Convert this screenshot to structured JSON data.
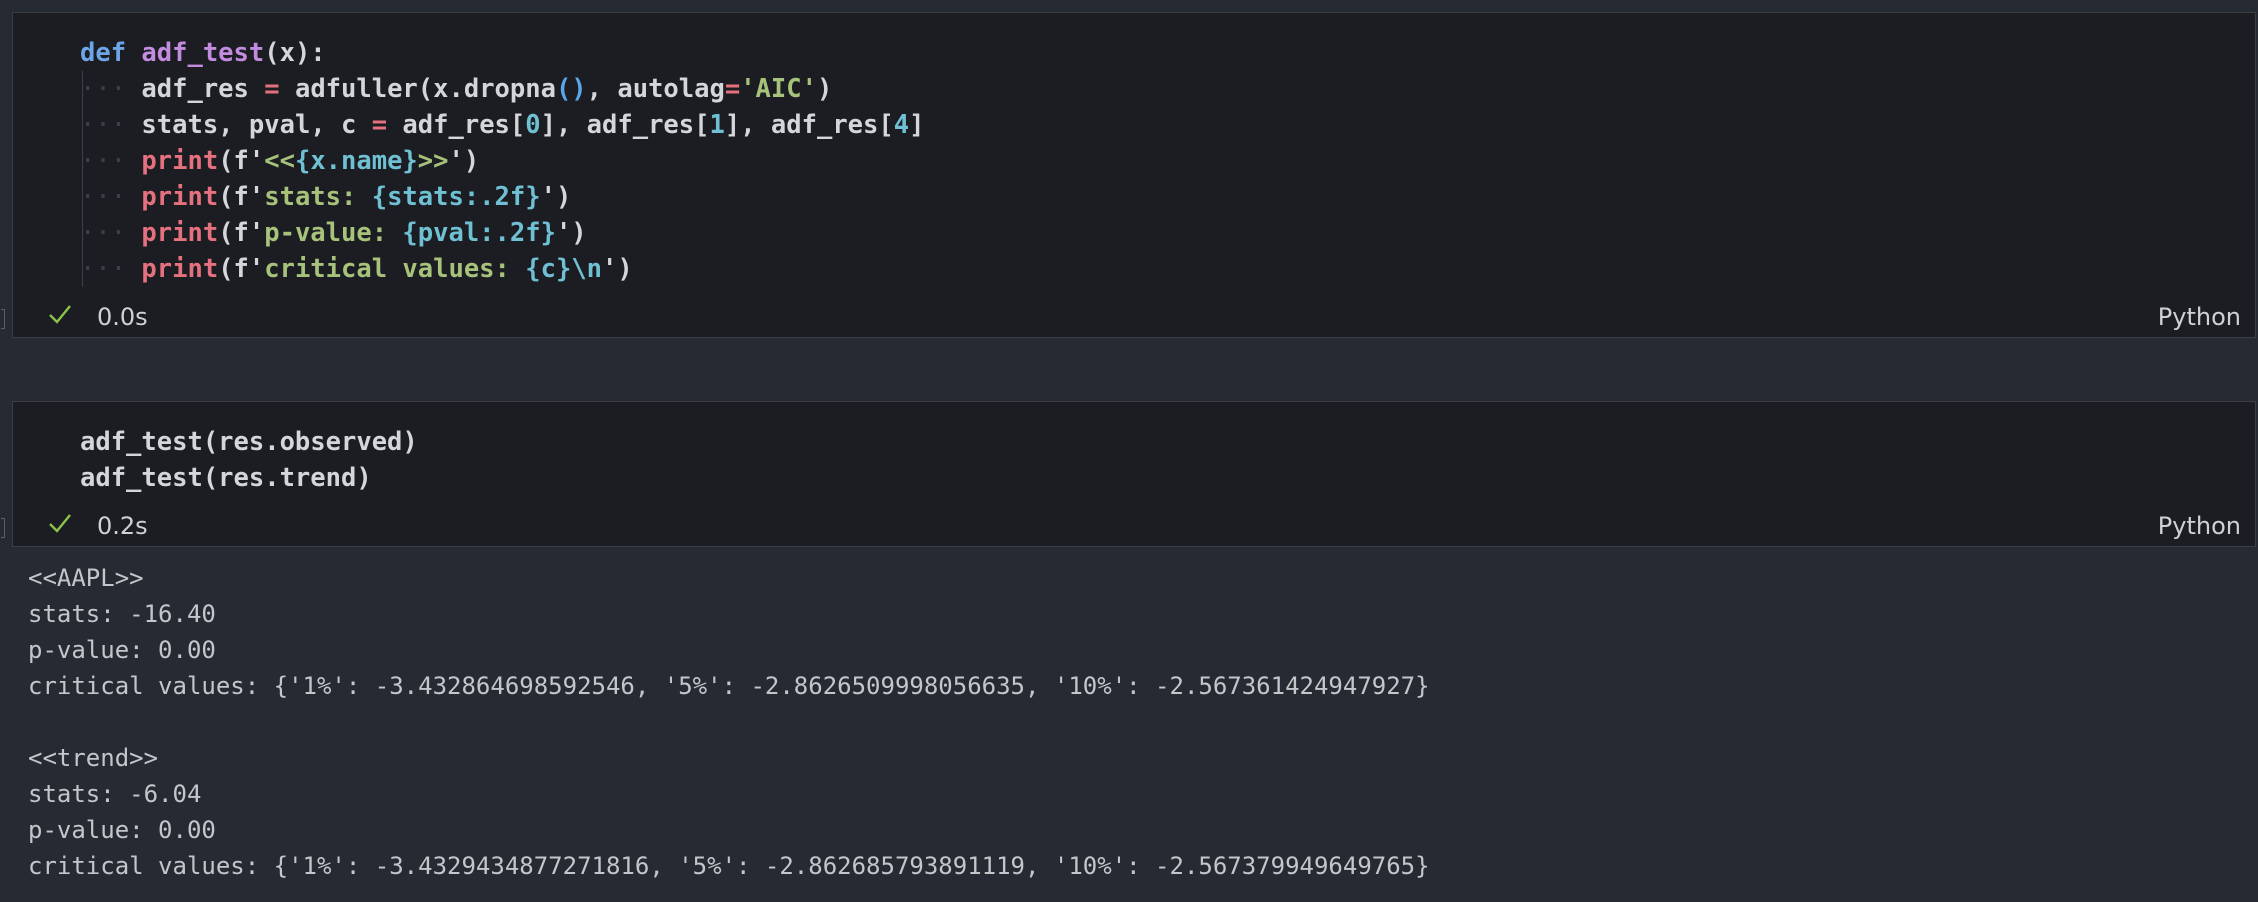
{
  "cell1": {
    "lines": [
      {
        "tokens": [
          {
            "t": "def ",
            "c": "kw"
          },
          {
            "t": "adf_test",
            "c": "fn"
          },
          {
            "t": "(x):",
            "c": "pn"
          }
        ]
      },
      {
        "tokens": [
          {
            "t": "adf_res ",
            "c": "pn"
          },
          {
            "t": "=",
            "c": "op"
          },
          {
            "t": " adfuller(x.dropna",
            "c": "pn"
          },
          {
            "t": "()",
            "c": "brk"
          },
          {
            "t": ", autolag",
            "c": "pn"
          },
          {
            "t": "=",
            "c": "op"
          },
          {
            "t": "'AIC'",
            "c": "str"
          },
          {
            "t": ")",
            "c": "pn"
          }
        ]
      },
      {
        "tokens": [
          {
            "t": "stats, pval, c ",
            "c": "pn"
          },
          {
            "t": "=",
            "c": "op"
          },
          {
            "t": " adf_res[",
            "c": "pn"
          },
          {
            "t": "0",
            "c": "num"
          },
          {
            "t": "], adf_res[",
            "c": "pn"
          },
          {
            "t": "1",
            "c": "num"
          },
          {
            "t": "], adf_res[",
            "c": "pn"
          },
          {
            "t": "4",
            "c": "num"
          },
          {
            "t": "]",
            "c": "pn"
          }
        ]
      },
      {
        "tokens": [
          {
            "t": "print",
            "c": "prn"
          },
          {
            "t": "(f'",
            "c": "pn"
          },
          {
            "t": "<<",
            "c": "str"
          },
          {
            "t": "{x.name}",
            "c": "interp"
          },
          {
            "t": ">>",
            "c": "str"
          },
          {
            "t": "')",
            "c": "pn"
          }
        ]
      },
      {
        "tokens": [
          {
            "t": "print",
            "c": "prn"
          },
          {
            "t": "(f'",
            "c": "pn"
          },
          {
            "t": "stats: ",
            "c": "str"
          },
          {
            "t": "{stats:.2f}",
            "c": "interp"
          },
          {
            "t": "')",
            "c": "pn"
          }
        ]
      },
      {
        "tokens": [
          {
            "t": "print",
            "c": "prn"
          },
          {
            "t": "(f'",
            "c": "pn"
          },
          {
            "t": "p-value: ",
            "c": "str"
          },
          {
            "t": "{pval:.2f}",
            "c": "interp"
          },
          {
            "t": "')",
            "c": "pn"
          }
        ]
      },
      {
        "tokens": [
          {
            "t": "print",
            "c": "prn"
          },
          {
            "t": "(f'",
            "c": "pn"
          },
          {
            "t": "critical values: ",
            "c": "str"
          },
          {
            "t": "{c}",
            "c": "interp"
          },
          {
            "t": "\\n",
            "c": "interp"
          },
          {
            "t": "')",
            "c": "pn"
          }
        ]
      }
    ],
    "status_icon": "check-icon",
    "time": "0.0s",
    "language": "Python"
  },
  "cell2": {
    "lines": [
      {
        "tokens": [
          {
            "t": "adf_test(res.observed)",
            "c": "pn"
          }
        ]
      },
      {
        "tokens": [
          {
            "t": "adf_test(res.trend)",
            "c": "pn"
          }
        ]
      }
    ],
    "status_icon": "check-icon",
    "time": "0.2s",
    "language": "Python"
  },
  "output": {
    "lines": [
      "<<AAPL>>",
      "stats: -16.40",
      "p-value: 0.00",
      "critical values: {'1%': -3.432864698592546, '5%': -2.8626509998056635, '10%': -2.567361424947927}",
      "",
      "<<trend>>",
      "stats: -6.04",
      "p-value: 0.00",
      "critical values: {'1%': -3.4329434877271816, '5%': -2.862685793891119, '10%': -2.567379949649765}"
    ]
  },
  "colors": {
    "background": "#262a33",
    "cell_background": "#1b1d23",
    "check": "#8bc34a"
  }
}
